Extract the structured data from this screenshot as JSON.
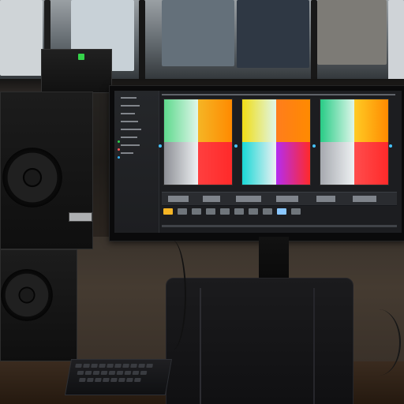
{
  "scene": {
    "colors": {
      "wall": "#3f3730",
      "desk": "#2d2016",
      "monitor_bg": "#1c1d20",
      "accent_green": "#34c759",
      "accent_blue": "#34b8ff"
    },
    "icons": {
      "window": "window-icon",
      "speaker": "speaker-icon",
      "monitor": "monitor-icon",
      "keyboard": "keyboard-icon"
    },
    "monitor_cards": [
      {
        "colors": [
          "#5fd98d",
          "#f5b525",
          "#8d8f95",
          "#ff3f3f"
        ]
      },
      {
        "colors": [
          "#f0dd15",
          "#ff7d1d",
          "#19d8d6",
          "#b42df1"
        ]
      },
      {
        "colors": [
          "#28cc86",
          "#ffcb24",
          "#a6a9af",
          "#ff4d4d"
        ]
      }
    ]
  }
}
